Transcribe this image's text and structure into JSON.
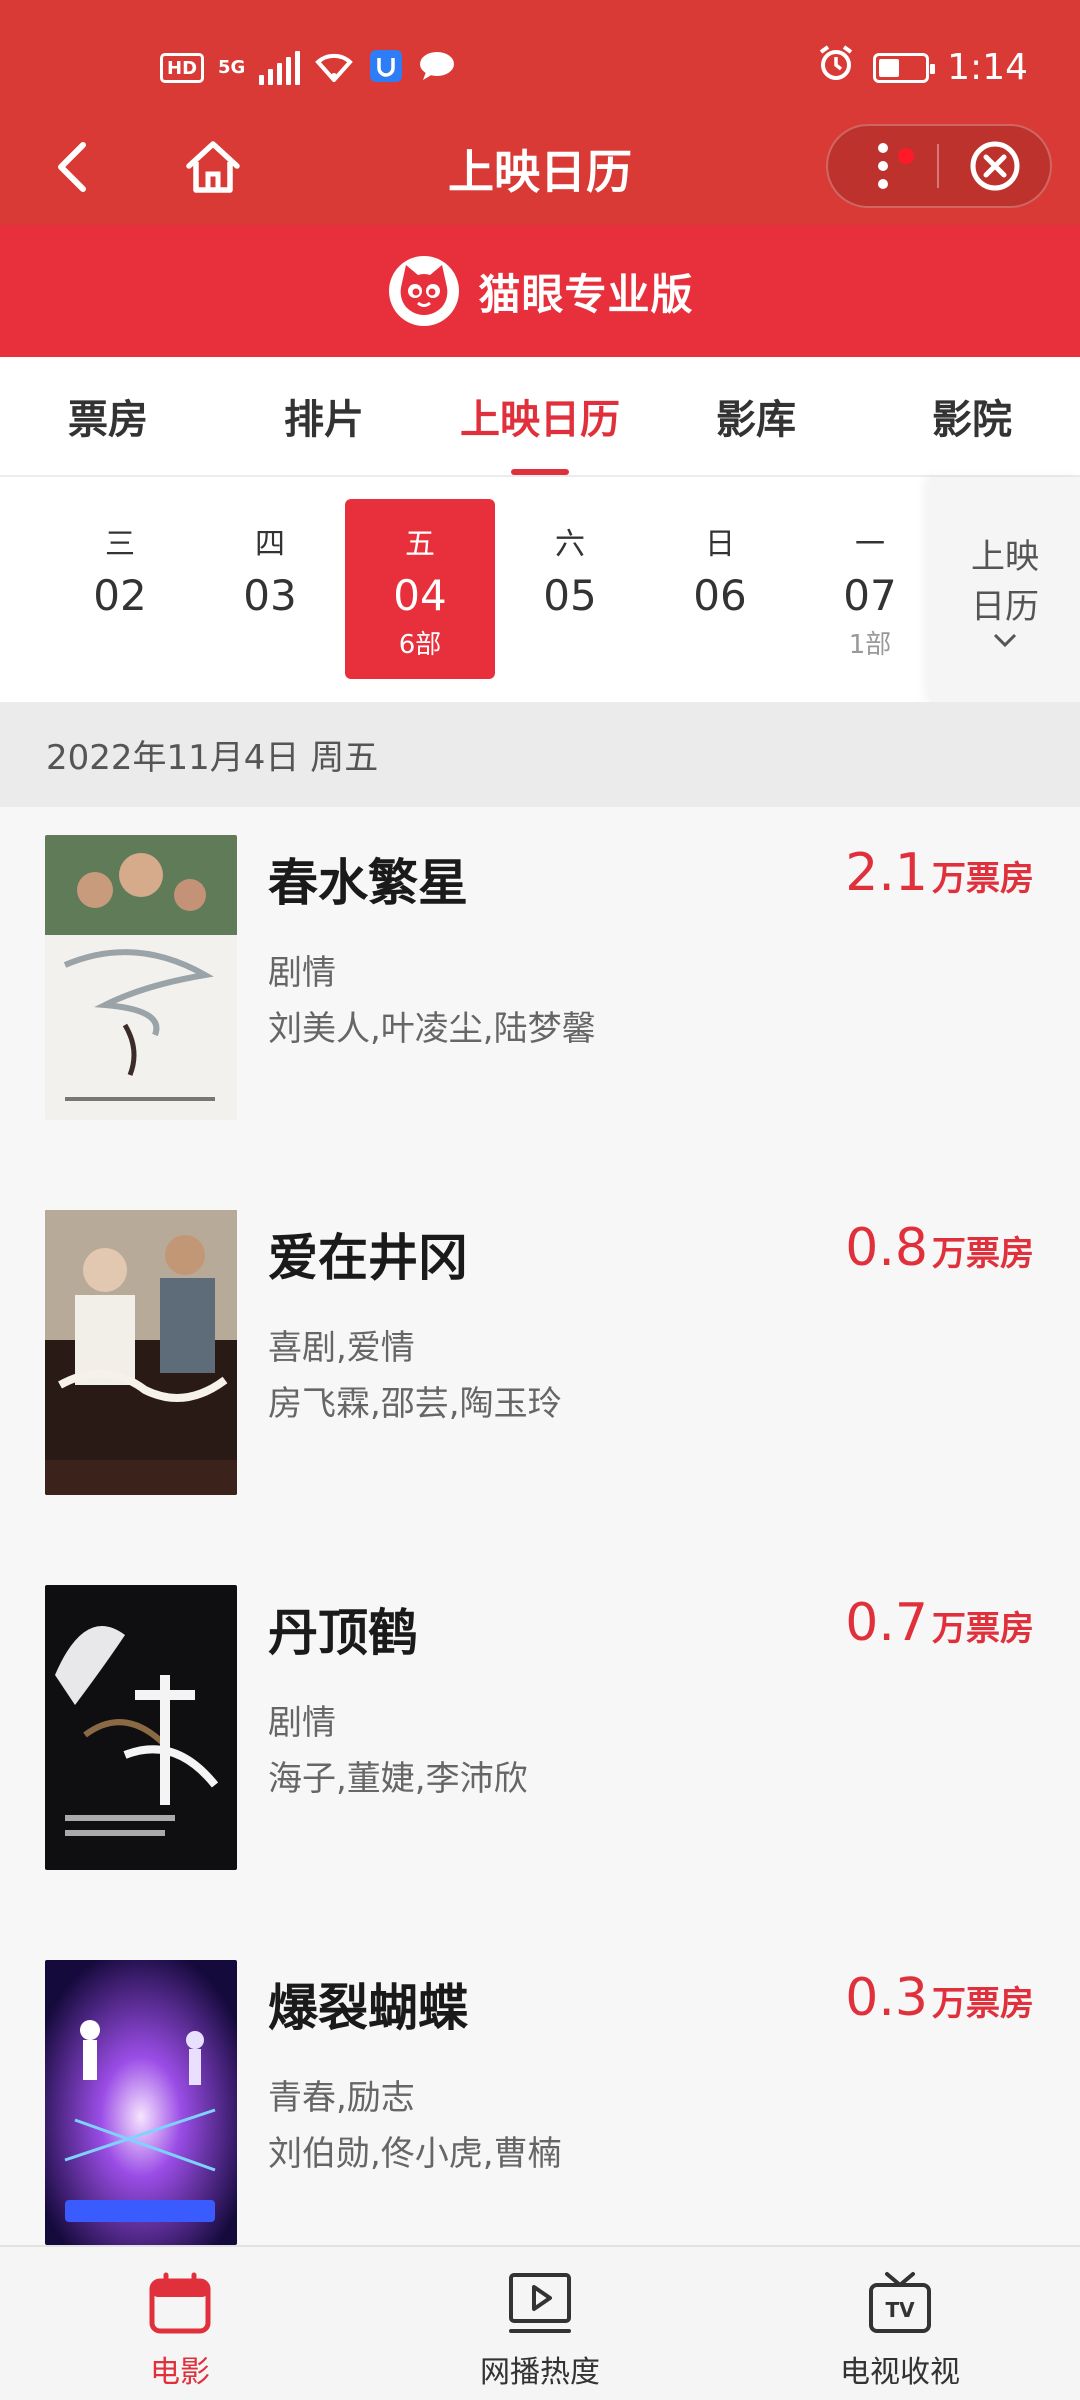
{
  "status_bar": {
    "time": "1:14",
    "hd_badge": "HD",
    "network_label": "5G",
    "battery_level_percent": 45
  },
  "nav": {
    "title": "上映日历",
    "back_icon": "back-arrow-icon",
    "home_icon": "home-icon",
    "more_icon": "more-vertical-icon",
    "close_icon": "close-circle-icon"
  },
  "brand": {
    "name": "猫眼专业版",
    "logo_icon": "cat-logo-icon"
  },
  "tabs": [
    {
      "label": "票房"
    },
    {
      "label": "排片"
    },
    {
      "label": "上映日历"
    },
    {
      "label": "影库"
    },
    {
      "label": "影院"
    }
  ],
  "active_tab": 2,
  "dates": [
    {
      "weekday": "三",
      "date": "02",
      "count": ""
    },
    {
      "weekday": "四",
      "date": "03",
      "count": ""
    },
    {
      "weekday": "五",
      "date": "04",
      "count": "6部"
    },
    {
      "weekday": "六",
      "date": "05",
      "count": ""
    },
    {
      "weekday": "日",
      "date": "06",
      "count": ""
    },
    {
      "weekday": "一",
      "date": "07",
      "count": "1部"
    }
  ],
  "calendar_toggle": {
    "label": "上映日历"
  },
  "date_header": "2022年11月4日 周五",
  "movies": [
    {
      "title": "春水繁星",
      "genre": "剧情",
      "cast": "刘美人,叶凌尘,陆梦馨",
      "box_value": "2.1",
      "box_unit": "万票房"
    },
    {
      "title": "爱在井冈",
      "genre": "喜剧,爱情",
      "cast": "房飞霖,邵芸,陶玉玲",
      "box_value": "0.8",
      "box_unit": "万票房"
    },
    {
      "title": "丹顶鹤",
      "genre": "剧情",
      "cast": "海子,董婕,李沛欣",
      "box_value": "0.7",
      "box_unit": "万票房"
    },
    {
      "title": "爆裂蝴蝶",
      "genre": "青春,励志",
      "cast": "刘伯勋,佟小虎,曹楠",
      "box_value": "0.3",
      "box_unit": "万票房"
    }
  ],
  "bottom_tabs": [
    {
      "label": "电影",
      "icon": "calendar-icon"
    },
    {
      "label": "网播热度",
      "icon": "play-screen-icon"
    },
    {
      "label": "电视收视",
      "icon": "tv-icon"
    }
  ],
  "colors": {
    "header_red": "#d93a35",
    "brand_red": "#e8303c",
    "accent": "#e0303b"
  }
}
